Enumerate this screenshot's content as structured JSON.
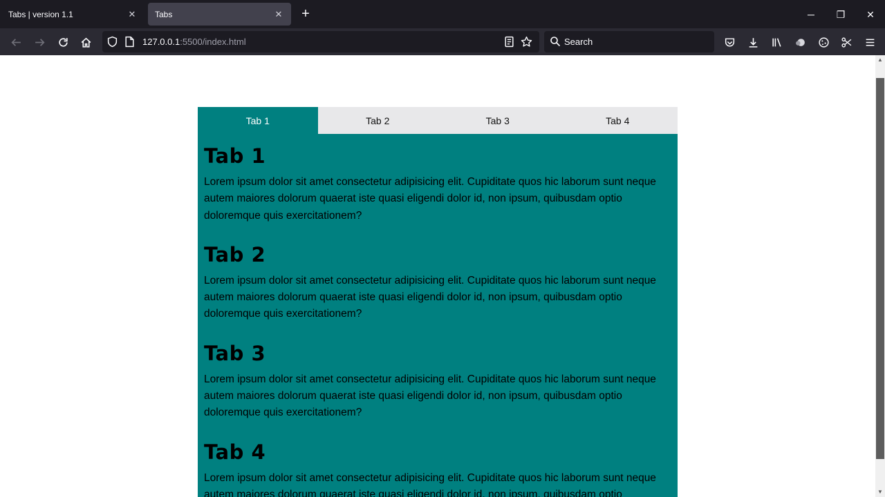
{
  "browser": {
    "tabs": [
      {
        "title": "Tabs | version 1.1"
      },
      {
        "title": "Tabs"
      }
    ],
    "url_host": "127.0.0.1",
    "url_rest": ":5500/index.html",
    "search_placeholder": "Search"
  },
  "page": {
    "tab_buttons": [
      {
        "label": "Tab 1"
      },
      {
        "label": "Tab 2"
      },
      {
        "label": "Tab 3"
      },
      {
        "label": "Tab 4"
      }
    ],
    "active_tab": 0,
    "sections": [
      {
        "heading": "Tab 1",
        "text": "Lorem ipsum dolor sit amet consectetur adipisicing elit. Cupiditate quos hic laborum sunt neque autem maiores dolorum quaerat iste quasi eligendi dolor id, non ipsum, quibusdam optio doloremque quis exercitationem?"
      },
      {
        "heading": "Tab 2",
        "text": "Lorem ipsum dolor sit amet consectetur adipisicing elit. Cupiditate quos hic laborum sunt neque autem maiores dolorum quaerat iste quasi eligendi dolor id, non ipsum, quibusdam optio doloremque quis exercitationem?"
      },
      {
        "heading": "Tab 3",
        "text": "Lorem ipsum dolor sit amet consectetur adipisicing elit. Cupiditate quos hic laborum sunt neque autem maiores dolorum quaerat iste quasi eligendi dolor id, non ipsum, quibusdam optio doloremque quis exercitationem?"
      },
      {
        "heading": "Tab 4",
        "text": "Lorem ipsum dolor sit amet consectetur adipisicing elit. Cupiditate quos hic laborum sunt neque autem maiores dolorum quaerat iste quasi eligendi dolor id, non ipsum, quibusdam optio doloremque quis exercitationem?"
      }
    ]
  },
  "colors": {
    "accent": "#008080",
    "tab_inactive": "#e8e8ea",
    "chrome_dark": "#1c1b22",
    "chrome_toolbar": "#2b2a33"
  }
}
